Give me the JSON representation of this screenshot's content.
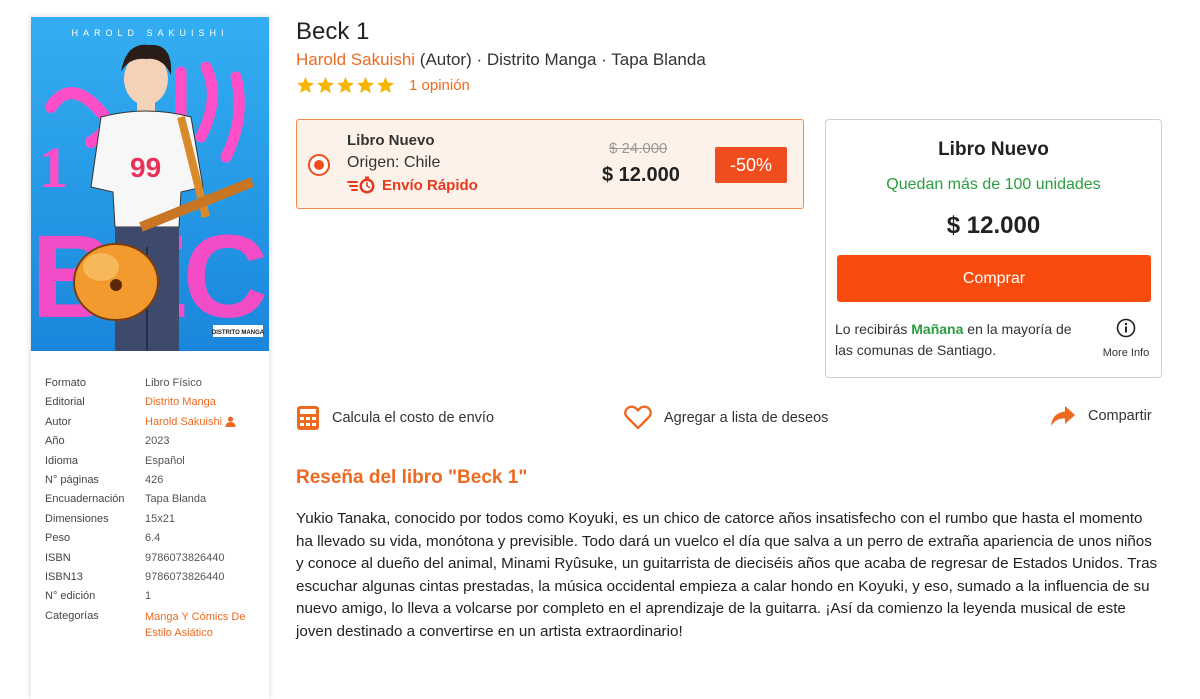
{
  "colors": {
    "accent": "#ef6a21",
    "button": "#fa4b0f",
    "success": "#2a9d3f",
    "discount": "#f04d1f"
  },
  "cover": {
    "author_band": "HAROLD SAKUISHI",
    "big_letters": "BECK",
    "volume": "1",
    "shirt_number": "99",
    "publisher_logo": "DISTRITO MANGA"
  },
  "specs": [
    {
      "key": "Formato",
      "value": "Libro Físico",
      "link": false
    },
    {
      "key": "Editorial",
      "value": "Distrito Manga",
      "link": true
    },
    {
      "key": "Autor",
      "value": "Harold Sakuishi",
      "link": true,
      "icon": "user-icon"
    },
    {
      "key": "Año",
      "value": "2023",
      "link": false
    },
    {
      "key": "Idioma",
      "value": "Español",
      "link": false
    },
    {
      "key": "N° páginas",
      "value": "426",
      "link": false
    },
    {
      "key": "Encuadernación",
      "value": "Tapa Blanda",
      "link": false
    },
    {
      "key": "Dimensiones",
      "value": "15x21",
      "link": false
    },
    {
      "key": "Peso",
      "value": "6.4",
      "link": false
    },
    {
      "key": "ISBN",
      "value": "9786073826440",
      "link": false
    },
    {
      "key": "ISBN13",
      "value": "9786073826440",
      "link": false
    },
    {
      "key": "N° edición",
      "value": "1",
      "link": false
    },
    {
      "key": "Categorías",
      "value": "Manga Y Cómics De Estilo Asiático",
      "link": true
    }
  ],
  "book": {
    "title": "Beck 1",
    "author": "Harold Sakuishi",
    "author_role": " (Autor)",
    "meta": " · Distrito Manga · Tapa Blanda",
    "rating_stars": 5,
    "opinions": "1 opinión"
  },
  "offer": {
    "condition": "Libro Nuevo",
    "origin": "Origen: Chile",
    "shipping": "Envío Rápido",
    "old_price": "$ 24.000",
    "price": "$ 12.000",
    "discount": "-50%"
  },
  "buy_box": {
    "condition": "Libro Nuevo",
    "stock": "Quedan más de 100 unidades",
    "price": "$ 12.000",
    "button": "Comprar",
    "delivery_prefix": "Lo recibirás ",
    "delivery_day": "Mañana",
    "delivery_suffix": " en la mayoría de las comunas de Santiago.",
    "more_info": "More Info"
  },
  "actions": {
    "shipping_calc": "Calcula el costo de envío",
    "wishlist": "Agregar a lista de deseos",
    "share": "Compartir"
  },
  "review": {
    "title": "Reseña del libro \"Beck 1\"",
    "text": "Yukio Tanaka, conocido por todos como Koyuki, es un chico de catorce años insatisfecho con el rumbo que hasta el momento ha llevado su vida, monótona y previsible. Todo dará un vuelco el día que salva a un perro de extraña apariencia de unos niños y conoce al dueño del animal, Minami Ryûsuke, un guitarrista de dieciséis años que acaba de regresar de Estados Unidos. Tras escuchar algunas cintas prestadas, la música occidental empieza a calar hondo en Koyuki, y eso, sumado a la influencia de su nuevo amigo, lo lleva a volcarse por completo en el aprendizaje de la guitarra. ¡Así da comienzo la leyenda musical de este joven destinado a convertirse en un artista extraordinario!"
  }
}
